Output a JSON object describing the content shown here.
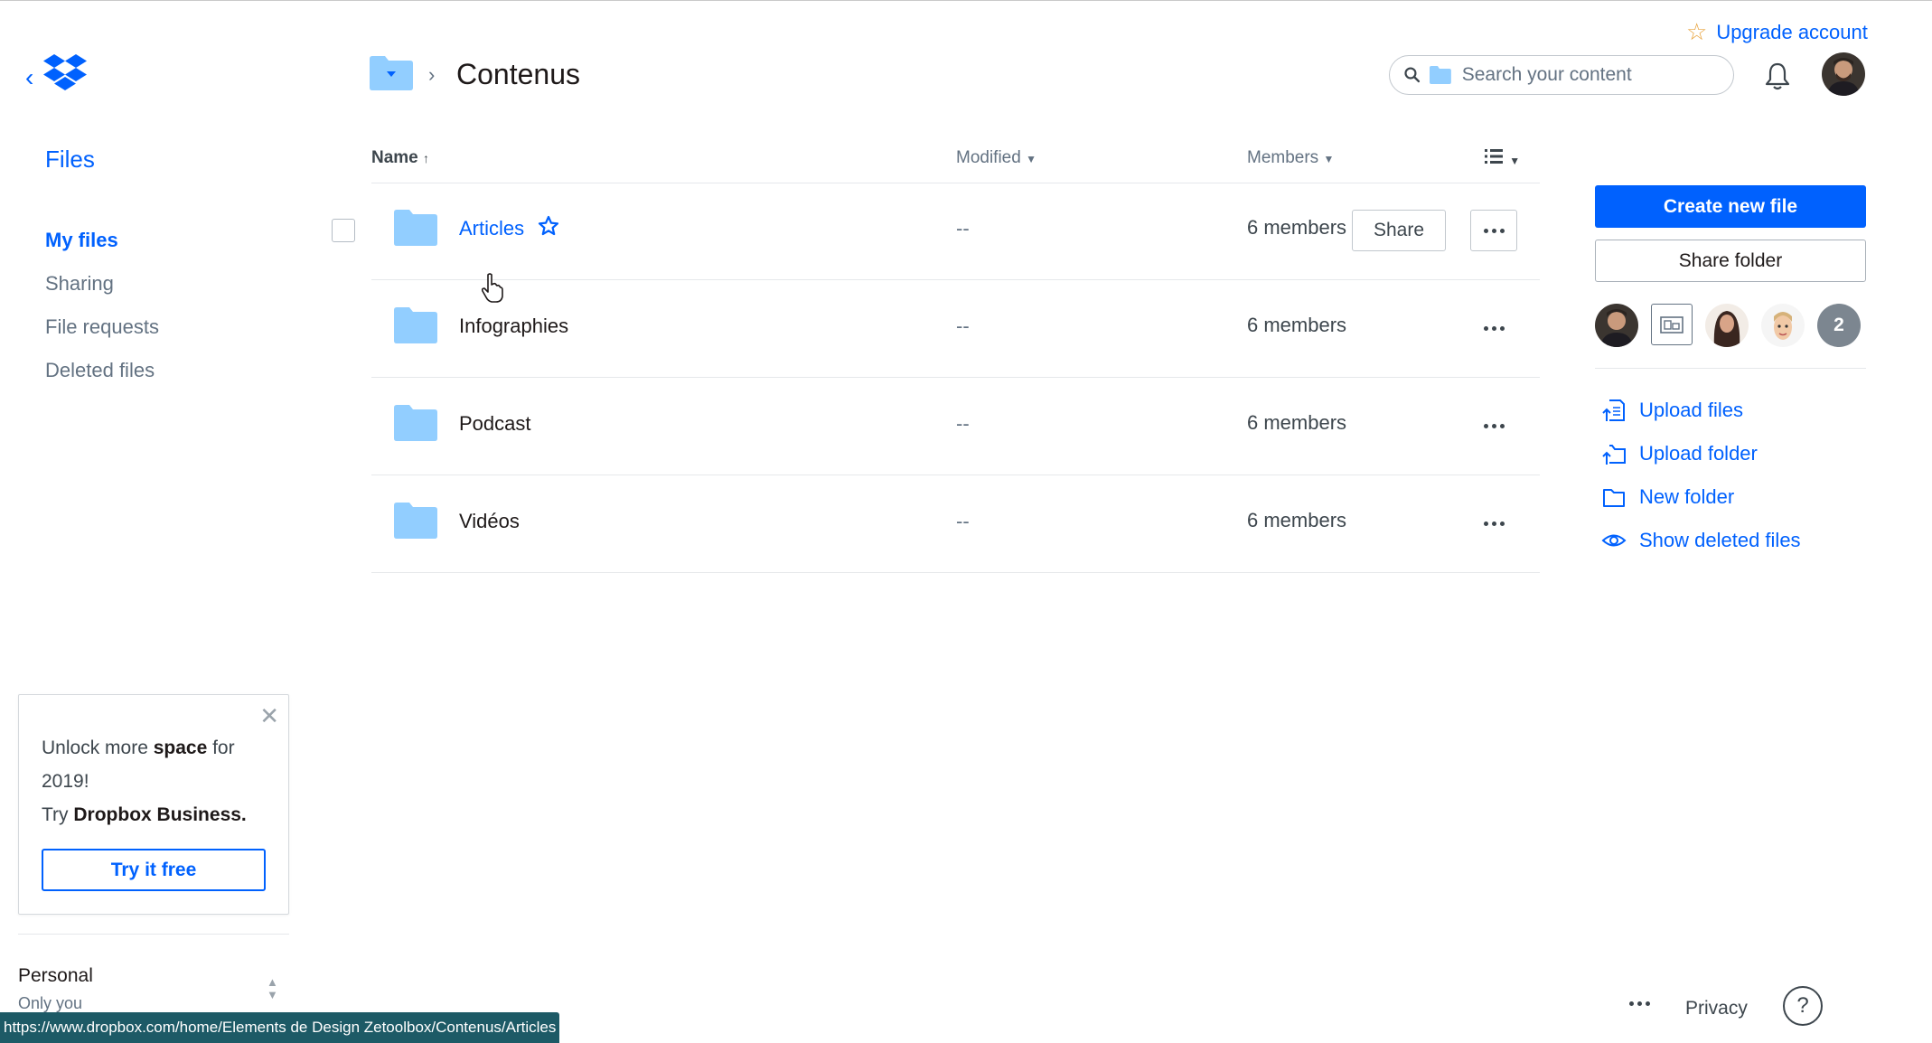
{
  "app": {
    "header": {
      "upgrade_label": "Upgrade account",
      "search_placeholder": "Search your content",
      "breadcrumb_title": "Contenus"
    },
    "sidebar": {
      "title": "Files",
      "items": [
        {
          "label": "My files",
          "active": true
        },
        {
          "label": "Sharing",
          "active": false
        },
        {
          "label": "File requests",
          "active": false
        },
        {
          "label": "Deleted files",
          "active": false
        }
      ]
    },
    "table": {
      "columns": {
        "name": "Name",
        "modified": "Modified",
        "members": "Members"
      },
      "rows": [
        {
          "name": "Articles",
          "modified": "--",
          "members": "6 members",
          "starred": true,
          "hovered": true,
          "share_label": "Share"
        },
        {
          "name": "Infographies",
          "modified": "--",
          "members": "6 members"
        },
        {
          "name": "Podcast",
          "modified": "--",
          "members": "6 members"
        },
        {
          "name": "Vidéos",
          "modified": "--",
          "members": "6 members"
        }
      ]
    },
    "right_panel": {
      "create_label": "Create new file",
      "share_folder_label": "Share folder",
      "extra_members_count": "2",
      "actions": [
        {
          "label": "Upload files",
          "icon": "upload-file-icon"
        },
        {
          "label": "Upload folder",
          "icon": "upload-folder-icon"
        },
        {
          "label": "New folder",
          "icon": "new-folder-icon"
        },
        {
          "label": "Show deleted files",
          "icon": "eye-icon"
        }
      ]
    },
    "promo": {
      "line1_pre": "Unlock more ",
      "line1_bold": "space",
      "line1_post": " for 2019!",
      "line2_pre": "Try ",
      "line2_bold": "Dropbox Business.",
      "button_label": "Try it free"
    },
    "account": {
      "name": "Personal",
      "sub": "Only you"
    },
    "footer": {
      "privacy_label": "Privacy",
      "help_label": "?"
    },
    "status_bar_url": "https://www.dropbox.com/home/Elements de Design Zetoolbox/Contenus/Articles",
    "colors": {
      "accent": "#0061fe",
      "folder": "#92ceff",
      "text": "#1e1919",
      "muted": "#637282"
    }
  }
}
